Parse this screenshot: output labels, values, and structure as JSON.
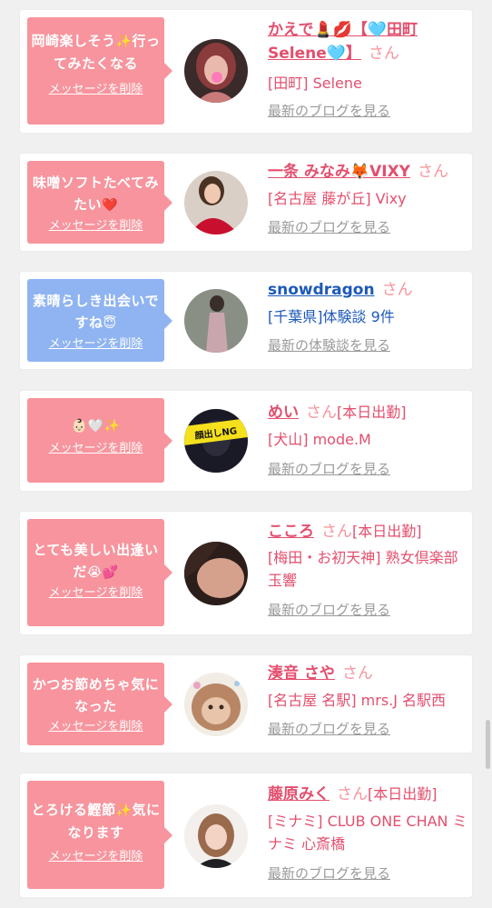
{
  "common": {
    "san": "さん",
    "delete_label": "メッセージを削除"
  },
  "colors": {
    "pink": "#f7949d",
    "blue": "#8fb4f1",
    "name_pink": "#e34f6e",
    "name_blue": "#1d59b8",
    "link_gray": "#9a9a9a"
  },
  "items": [
    {
      "message_line1": "岡崎楽しそう",
      "message_emoji": "✨",
      "message_line2": "行ってみたくなる",
      "name": "かえで💄💋【🩵田町Selene🩵】",
      "status": "",
      "shop": "[田町] Selene",
      "link": "最新のブログを見る"
    },
    {
      "message_line1": "味噌ソフトたべてみたい",
      "message_emoji": "❤️",
      "message_line2": "",
      "name": "一条 みなみ🦊VIXY",
      "status": "",
      "shop": "[名古屋 藤が丘] Vixy",
      "link": "最新のブログを見る"
    },
    {
      "message_line1": "素晴らしき出会いですね",
      "message_emoji": "😇",
      "message_line2": "",
      "name": "snowdragon",
      "status": "",
      "shop": "[千葉県]体験談 9件",
      "link": "最新の体験談を見る"
    },
    {
      "message_line1": "",
      "message_emoji": "👶🏻🤍✨",
      "message_line2": "",
      "name": "めい",
      "status": "[本日出勤]",
      "shop": "[犬山] mode.M",
      "link": "最新のブログを見る",
      "avatar_text": "顔出しNG"
    },
    {
      "message_line1": "とても美しい出逢いだ",
      "message_emoji": "😭💕",
      "message_line2": "",
      "name": "こころ",
      "status": "[本日出勤]",
      "shop": "[梅田・お初天神] 熟女倶楽部 玉響",
      "link": "最新のブログを見る"
    },
    {
      "message_line1": "かつお節めちゃ気になった",
      "message_emoji": "",
      "message_line2": "",
      "name": "湊音 さや",
      "status": "",
      "shop": "[名古屋 名駅] mrs.J 名駅西",
      "link": "最新のブログを見る"
    },
    {
      "message_line1": "とろける鰹節",
      "message_emoji": "✨",
      "message_line2": "気になります",
      "name": "藤原みく",
      "status": "[本日出勤]",
      "shop": "[ミナミ] CLUB ONE CHAN ミナミ 心斎橋",
      "link": "最新のブログを見る"
    }
  ]
}
